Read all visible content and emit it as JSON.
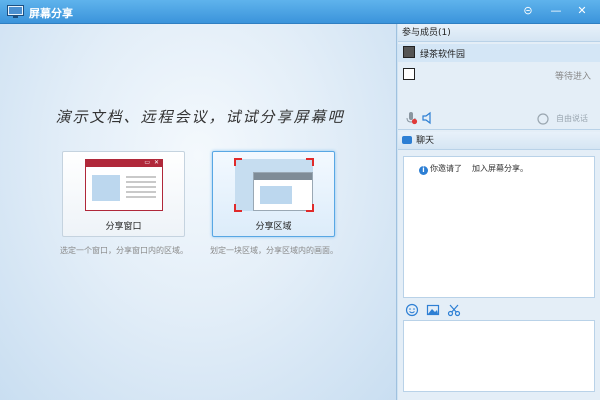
{
  "window": {
    "title": "屏幕分享",
    "controls": {
      "extra": "⊝",
      "minimize": "—",
      "close": "✕"
    }
  },
  "main": {
    "slogan": "演示文档、远程会议，试试分享屏幕吧",
    "options": [
      {
        "label": "分享窗口",
        "description": "选定一个窗口，分享窗口内的区域。"
      },
      {
        "label": "分享区域",
        "description": "划定一块区域，分享区域内的画面。"
      }
    ]
  },
  "sidebar": {
    "members_header": "参与成员(1)",
    "members": [
      {
        "name": "绿茶软件园",
        "status": ""
      },
      {
        "name": "",
        "status": "等待进入"
      }
    ],
    "voice_toolbar": {
      "free_speak": "自由说话"
    },
    "chat_header": "聊天",
    "chat_messages": [
      {
        "prefix": "你邀请了",
        "suffix": "加入屏幕分享。"
      }
    ]
  },
  "colors": {
    "titlebar": "#3b94db",
    "accent_border": "#58a7e4",
    "window_red": "#b0283a",
    "corner_red": "#e02a2a"
  },
  "icons": [
    "app-icon",
    "mic-icon",
    "speaker-icon",
    "free-speak-icon",
    "chat-icon",
    "info-icon",
    "emoji-icon",
    "image-icon",
    "scissors-icon"
  ]
}
